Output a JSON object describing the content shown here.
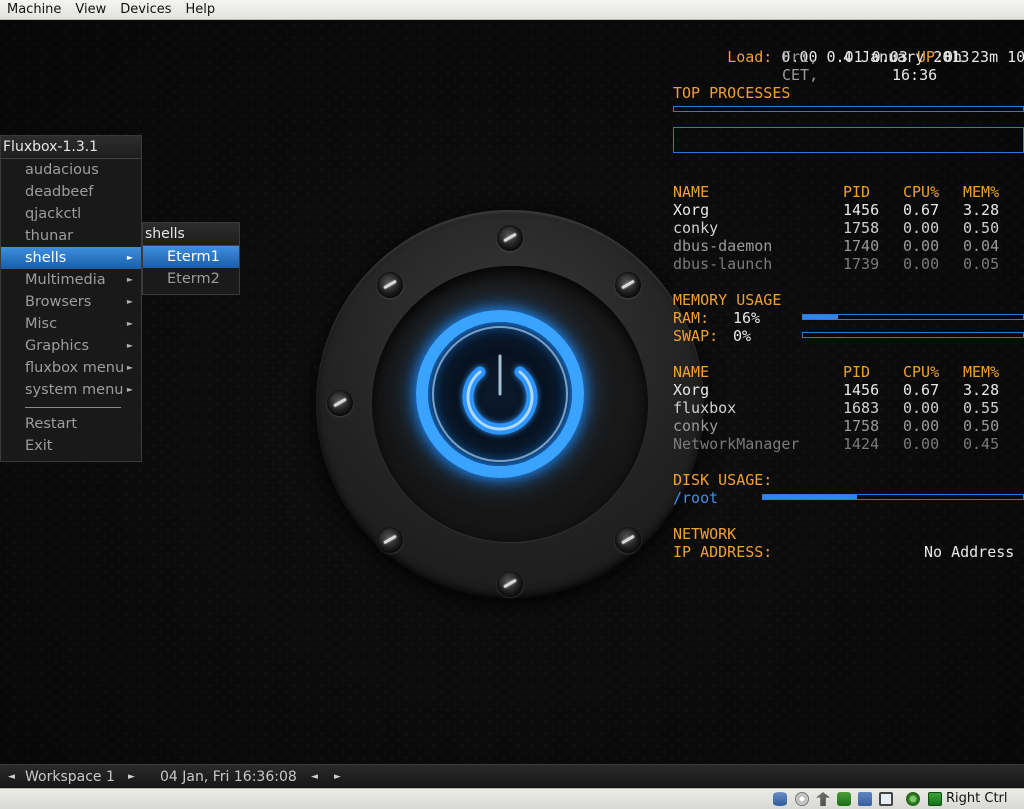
{
  "host_menubar": {
    "items": [
      "Machine",
      "View",
      "Devices",
      "Help"
    ]
  },
  "fluxbox_menu": {
    "title": "Fluxbox-1.3.1",
    "items": [
      {
        "label": "audacious",
        "submenu": false
      },
      {
        "label": "deadbeef",
        "submenu": false
      },
      {
        "label": "qjackctl",
        "submenu": false
      },
      {
        "label": "thunar",
        "submenu": false
      },
      {
        "label": "shells",
        "submenu": true,
        "selected": true
      },
      {
        "label": "Multimedia",
        "submenu": true
      },
      {
        "label": "Browsers",
        "submenu": true
      },
      {
        "label": "Misc",
        "submenu": true
      },
      {
        "label": "Graphics",
        "submenu": true
      },
      {
        "label": "fluxbox menu",
        "submenu": true
      },
      {
        "label": "system menu",
        "submenu": true
      }
    ],
    "footer_items": [
      "Restart",
      "Exit"
    ],
    "submenu_arrow": "►"
  },
  "shells_submenu": {
    "title": "shells",
    "items": [
      {
        "label": "Eterm1",
        "selected": true
      },
      {
        "label": "Eterm2",
        "selected": false
      }
    ]
  },
  "conky": {
    "load_label": "Load:",
    "load_value": "0.00 0.01 0.03",
    "uptime_label": "UP:",
    "uptime_value": "0h 23m 10s",
    "day": "Fri,",
    "date": "4 January 2013",
    "timezone": "CET,",
    "time": "16:36",
    "top_processes_heading": "TOP PROCESSES",
    "columns": [
      "NAME",
      "PID",
      "CPU%",
      "MEM%"
    ],
    "top_cpu": [
      {
        "name": "Xorg",
        "pid": "1456",
        "cpu": "0.67",
        "mem": "3.28"
      },
      {
        "name": "conky",
        "pid": "1758",
        "cpu": "0.00",
        "mem": "0.50"
      },
      {
        "name": "dbus-daemon",
        "pid": "1740",
        "cpu": "0.00",
        "mem": "0.04"
      },
      {
        "name": "dbus-launch",
        "pid": "1739",
        "cpu": "0.00",
        "mem": "0.05"
      }
    ],
    "memory_heading": "MEMORY USAGE",
    "ram_label": "RAM:",
    "ram_value": "16%",
    "ram_fraction": 0.16,
    "swap_label": "SWAP:",
    "swap_value": "0%",
    "swap_fraction": 0,
    "top_mem": [
      {
        "name": "Xorg",
        "pid": "1456",
        "cpu": "0.67",
        "mem": "3.28"
      },
      {
        "name": "fluxbox",
        "pid": "1683",
        "cpu": "0.00",
        "mem": "0.55"
      },
      {
        "name": "conky",
        "pid": "1758",
        "cpu": "0.00",
        "mem": "0.50"
      },
      {
        "name": "NetworkManager",
        "pid": "1424",
        "cpu": "0.00",
        "mem": "0.45"
      }
    ],
    "disk_heading": "DISK USAGE:",
    "disk_label": "/root",
    "disk_fraction": 0.36,
    "network_heading": "NETWORK",
    "ip_label": "IP ADDRESS:",
    "ip_value": "No Address",
    "colors": {
      "accent": "#f0a030",
      "bar": "#2d86ee",
      "text": "#e8e8e8"
    }
  },
  "toolbar": {
    "workspace": "Workspace 1",
    "clock": "04 Jan, Fri 16:36:08",
    "prev_arrow": "◄",
    "next_arrow": "►"
  },
  "statusbar": {
    "host_key": "Right Ctrl",
    "icons": [
      "hard-disk-icon",
      "optical-drive-icon",
      "usb-icon",
      "network-icon",
      "shared-folders-icon",
      "display-icon",
      "capture-icon",
      "mouse-integration-icon",
      "keyboard-capture-icon"
    ]
  }
}
